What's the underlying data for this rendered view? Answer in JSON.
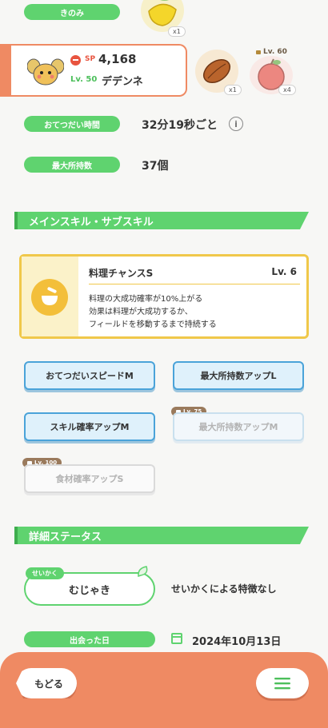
{
  "berry": {
    "label": "きのみ",
    "qty": "x1"
  },
  "pokemon": {
    "sp_label": "SP",
    "sp_value": "4,168",
    "level": "Lv. 50",
    "name": "デデンネ"
  },
  "ingredients": [
    {
      "qty": "x1"
    },
    {
      "qty": "x4",
      "lock": "Lv. 60"
    }
  ],
  "help_interval": {
    "label": "おてつだい時間",
    "value": "32分19秒ごと"
  },
  "max_carry": {
    "label": "最大所持数",
    "value": "37個"
  },
  "skills_section": {
    "title": "メインスキル・サブスキル"
  },
  "main_skill": {
    "name": "料理チャンスS",
    "level": "Lv. 6",
    "description": [
      "料理の大成功確率が10%上がる",
      "効果は料理が大成功するか、",
      "フィールドを移動するまで持続する"
    ]
  },
  "sub_skills": [
    {
      "label": "おてつだいスピードM"
    },
    {
      "label": "最大所持数アップL"
    },
    {
      "label": "スキル確率アップM"
    },
    {
      "label": "最大所持数アップM",
      "lock": "Lv. 75"
    },
    {
      "label": "食材確率アップS",
      "lock": "Lv. 100"
    }
  ],
  "details_section": {
    "title": "詳細ステータス"
  },
  "nature": {
    "tag": "せいかく",
    "value": "むじゃき",
    "effect": "せいかくによる特徴なし"
  },
  "met_date": {
    "label": "出会った日",
    "value": "2024年10月13日"
  },
  "footer": {
    "back_label": "もどる"
  },
  "colors": {
    "accent_green": "#5fd36f",
    "footer_orange": "#ef8a63",
    "skill_border": "#f0c84a"
  }
}
